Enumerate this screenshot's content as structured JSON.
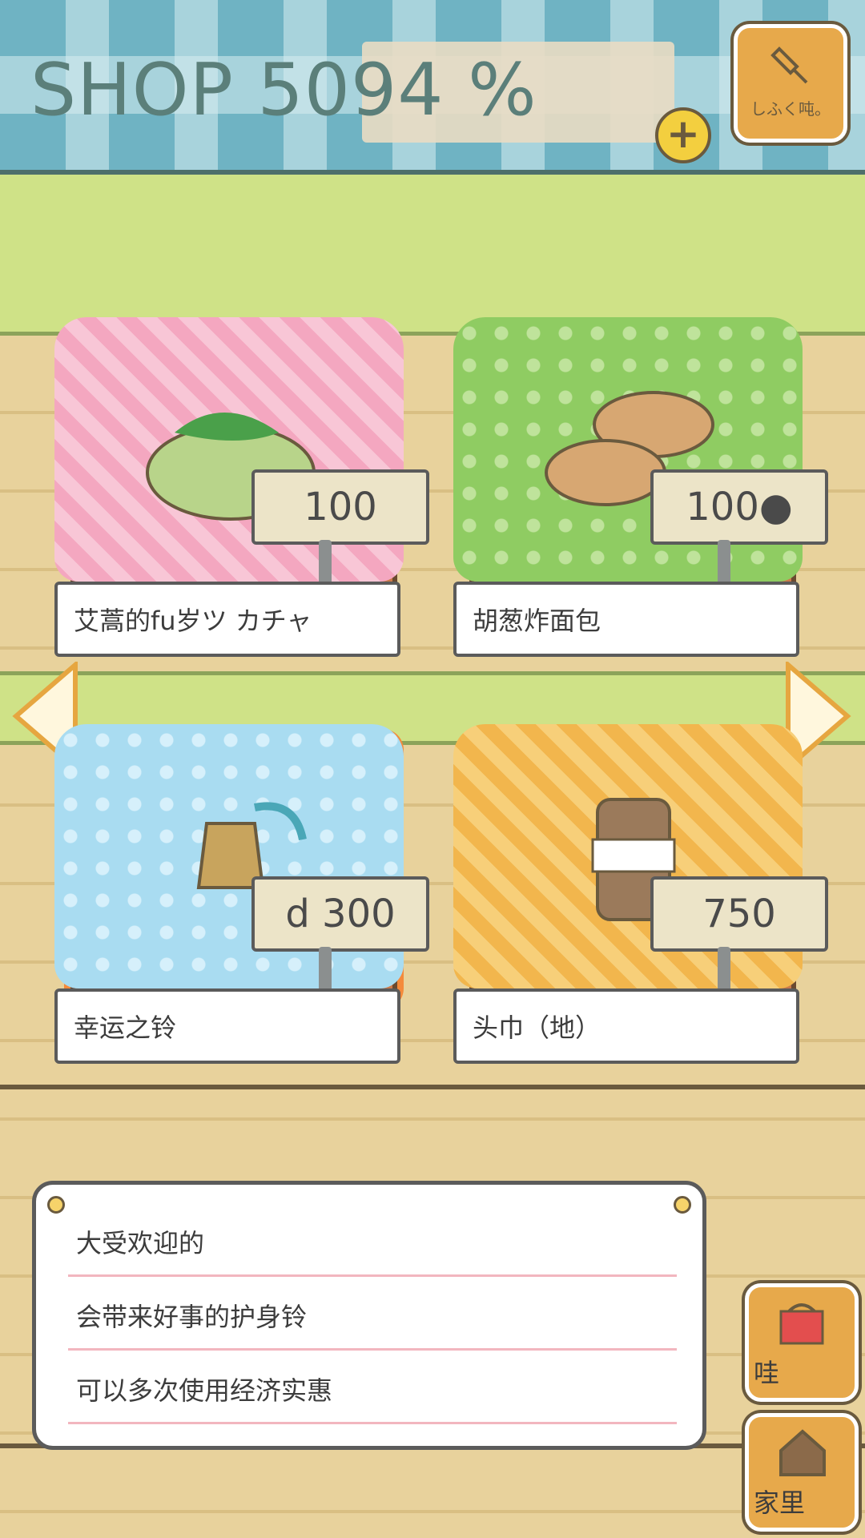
{
  "header": {
    "title": "SHOP 5094 %",
    "bell_label": "しふく吨。"
  },
  "icons": {
    "plus": "plus-icon",
    "bell": "bell-icon",
    "arrow_left": "arrow-left-icon",
    "arrow_right": "arrow-right-icon",
    "bag": "bag-icon",
    "house": "house-icon"
  },
  "items": [
    {
      "price": "100",
      "name": "艾蒿的fu岁ツ カチャ"
    },
    {
      "price": "100●",
      "name": "胡葱炸面包"
    },
    {
      "price": "d 300",
      "name": "幸运之铃"
    },
    {
      "price": "750",
      "name": "头巾（地）"
    }
  ],
  "description": {
    "lines": [
      "大受欢迎的",
      "会带来好事的护身铃",
      "可以多次使用经济实惠"
    ]
  },
  "side": {
    "bag_label": "哇",
    "home_label": "家里"
  },
  "colors": {
    "accent": "#f48a3b",
    "button": "#e7a94b",
    "awning": "#6fb3c3"
  }
}
